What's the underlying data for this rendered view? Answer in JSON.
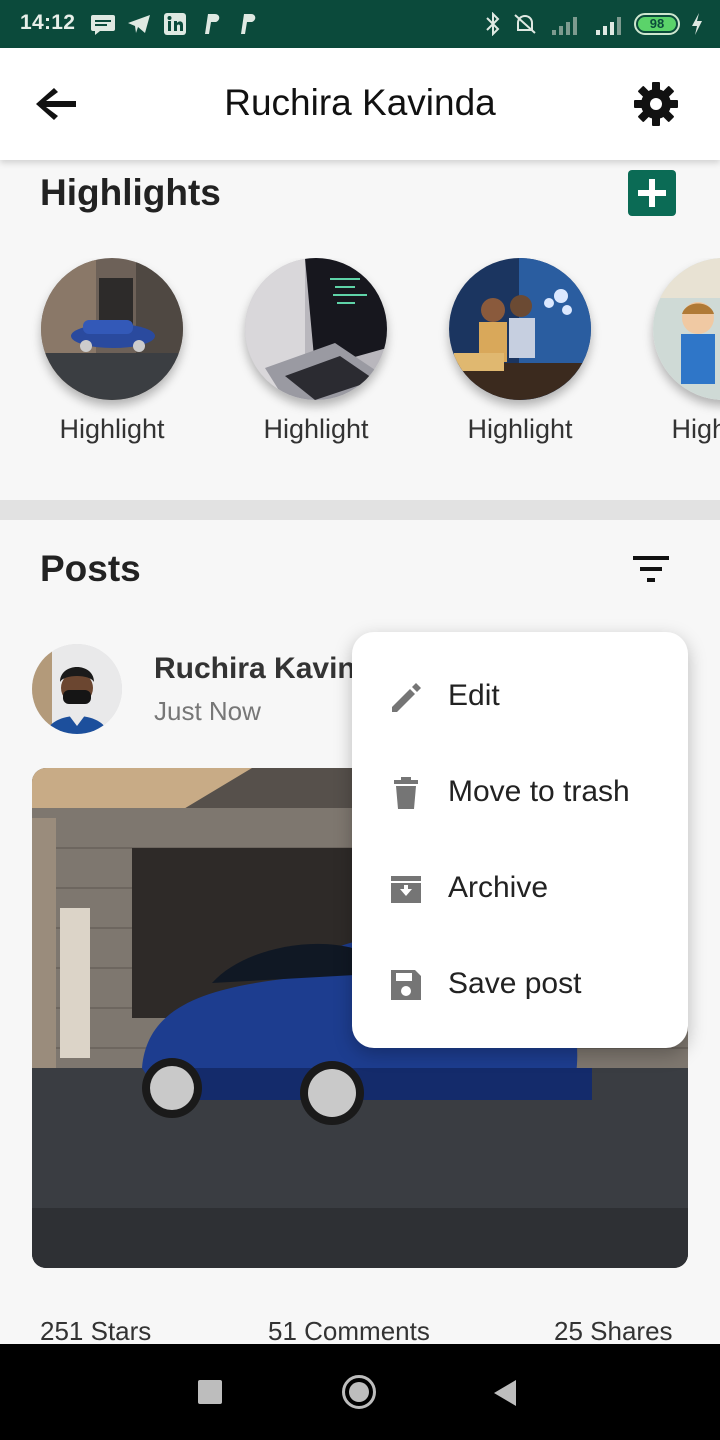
{
  "status_bar": {
    "time": "14:12",
    "battery_level": "98",
    "icons": [
      "message-icon",
      "telegram-icon",
      "linkedin-icon",
      "paypal-icon",
      "paypal-icon",
      "bluetooth-icon",
      "silent-icon",
      "signal-4g-icon",
      "signal-icon",
      "battery-icon",
      "charging-icon"
    ]
  },
  "app_bar": {
    "title": "Ruchira Kavinda",
    "back_icon": "arrow-back-icon",
    "settings_icon": "gear-icon"
  },
  "highlights": {
    "title": "Highlights",
    "add_icon": "plus-icon",
    "items": [
      {
        "label": "Highlight"
      },
      {
        "label": "Highlight"
      },
      {
        "label": "Highlight"
      },
      {
        "label": "Highlight"
      }
    ]
  },
  "posts": {
    "title": "Posts",
    "filter_icon": "filter-icon",
    "post": {
      "author": "Ruchira Kavinda",
      "time": "Just Now",
      "stats": {
        "stars": "251 Stars",
        "comments": "51 Comments",
        "shares": "25 Shares"
      }
    }
  },
  "menu": {
    "items": [
      {
        "label": "Edit",
        "icon": "pencil-icon"
      },
      {
        "label": "Move to trash",
        "icon": "trash-icon"
      },
      {
        "label": "Archive",
        "icon": "archive-icon"
      },
      {
        "label": "Save post",
        "icon": "save-icon"
      }
    ]
  },
  "colors": {
    "status_bar": "#0b4a3b",
    "accent": "#0b6b55",
    "background": "#f7f7f7"
  }
}
